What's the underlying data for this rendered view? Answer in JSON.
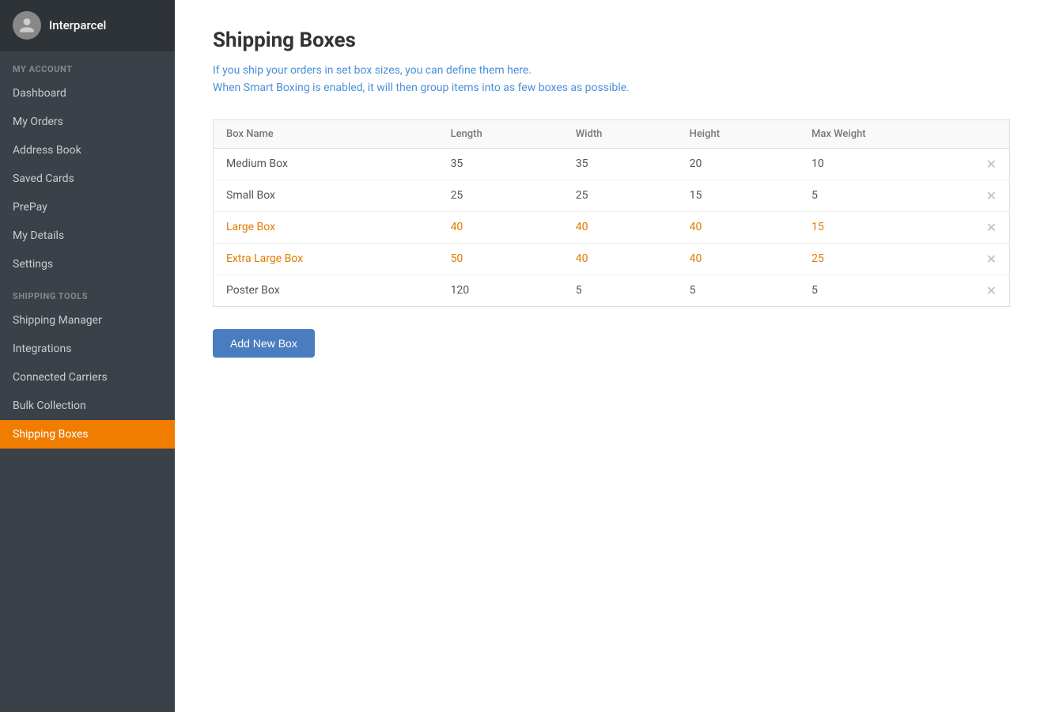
{
  "sidebar": {
    "brand": "Interparcel",
    "sections": [
      {
        "label": "MY ACCOUNT",
        "items": [
          {
            "id": "dashboard",
            "label": "Dashboard",
            "active": false
          },
          {
            "id": "my-orders",
            "label": "My Orders",
            "active": false
          },
          {
            "id": "address-book",
            "label": "Address Book",
            "active": false
          },
          {
            "id": "saved-cards",
            "label": "Saved Cards",
            "active": false
          },
          {
            "id": "prepay",
            "label": "PrePay",
            "active": false
          },
          {
            "id": "my-details",
            "label": "My Details",
            "active": false
          },
          {
            "id": "settings",
            "label": "Settings",
            "active": false
          }
        ]
      },
      {
        "label": "SHIPPING TOOLS",
        "items": [
          {
            "id": "shipping-manager",
            "label": "Shipping Manager",
            "active": false
          },
          {
            "id": "integrations",
            "label": "Integrations",
            "active": false
          },
          {
            "id": "connected-carriers",
            "label": "Connected Carriers",
            "active": false
          },
          {
            "id": "bulk-collection",
            "label": "Bulk Collection",
            "active": false
          },
          {
            "id": "shipping-boxes",
            "label": "Shipping Boxes",
            "active": true
          }
        ]
      }
    ]
  },
  "page": {
    "title": "Shipping Boxes",
    "description_line1": "If you ship your orders in set box sizes, you can define them here.",
    "description_line2": "When Smart Boxing is enabled, it will then group items into as few boxes as possible."
  },
  "table": {
    "headers": [
      "Box Name",
      "Length",
      "Width",
      "Height",
      "Max Weight",
      ""
    ],
    "rows": [
      {
        "name": "Medium Box",
        "length": "35",
        "width": "35",
        "height": "20",
        "max_weight": "10",
        "orange": false
      },
      {
        "name": "Small Box",
        "length": "25",
        "width": "25",
        "height": "15",
        "max_weight": "5",
        "orange": false
      },
      {
        "name": "Large Box",
        "length": "40",
        "width": "40",
        "height": "40",
        "max_weight": "15",
        "orange": true
      },
      {
        "name": "Extra Large Box",
        "length": "50",
        "width": "40",
        "height": "40",
        "max_weight": "25",
        "orange": true
      },
      {
        "name": "Poster Box",
        "length": "120",
        "width": "5",
        "height": "5",
        "max_weight": "5",
        "orange": false
      }
    ]
  },
  "buttons": {
    "add_new_box": "Add New Box"
  }
}
